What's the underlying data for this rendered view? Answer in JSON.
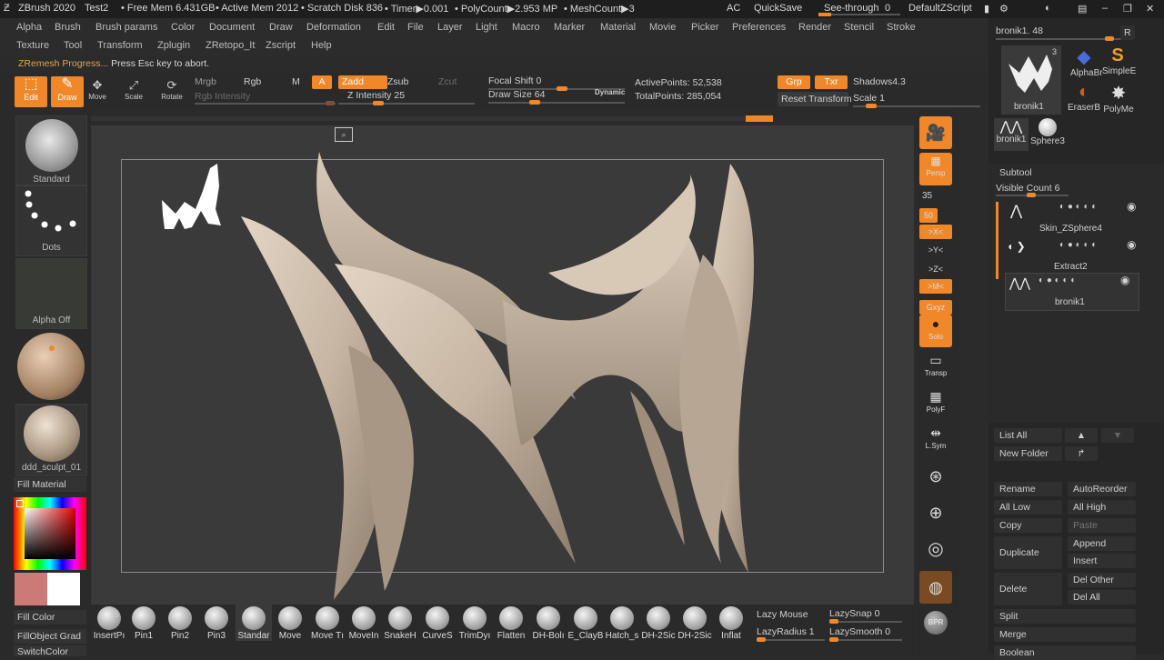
{
  "titlebar": {
    "app": "ZBrush 2020",
    "doc": "Test2",
    "free_mem": "• Free Mem 6.431GB",
    "active_mem": "• Active Mem 2012",
    "scratch": "• Scratch Disk 836",
    "timer": "• Timer▶0.001",
    "polycount": "• PolyCount▶2.953 MP",
    "meshcount": "• MeshCount▶3",
    "ac": "AC",
    "quicksave": "QuickSave",
    "seethrough": "See-through",
    "seethrough_val": "0",
    "zscript": "DefaultZScript"
  },
  "menu": {
    "row1": [
      "Alpha",
      "Brush",
      "Brush params",
      "Color",
      "Document",
      "Draw",
      "Deformation",
      "Edit",
      "File",
      "Layer",
      "Light",
      "Macro",
      "Marker",
      "Material",
      "Movie",
      "Picker",
      "Preferences",
      "Render",
      "Stencil",
      "Stroke"
    ],
    "row2": [
      "Texture",
      "Tool",
      "Transform",
      "Zplugin",
      "ZRetopo_It",
      "Zscript",
      "Help"
    ]
  },
  "status": {
    "progress": "ZRemesh Progress...",
    "hint": "Press Esc key to abort."
  },
  "toolbar": {
    "edit": "Edit",
    "draw": "Draw",
    "move": "Move",
    "scale": "Scale",
    "rotate": "Rotate",
    "mrgb": "Mrgb",
    "rgb": "Rgb",
    "m": "M",
    "a": "A",
    "rgb_intensity": "Rgb Intensity",
    "zadd": "Zadd",
    "zsub": "Zsub",
    "zcut": "Zcut",
    "z_intensity": "Z Intensity 25",
    "focal_shift": "Focal Shift 0",
    "draw_size": "Draw Size 64",
    "dynamic": "Dynamic",
    "active_points": "ActivePoints: 52,538",
    "total_points": "TotalPoints: 285,054",
    "grp": "Grp",
    "txr": "Txr",
    "shadows": "Shadows4.3",
    "reset_transform": "Reset Transform",
    "scale_val": "Scale 1",
    "z_intensity_frac": 0.25,
    "draw_size_frac": 0.3,
    "focal_shift_frac": 0.5,
    "scale_frac": 0.1
  },
  "left": {
    "brush": "Standard",
    "stroke": "Dots",
    "alpha": "Alpha Off",
    "material": "ddd_sculpt_01",
    "fill_material": "Fill Material",
    "fill_color": "Fill Color",
    "fill_object": "FillObject Grad",
    "switch_color": "SwitchColor"
  },
  "shelf": {
    "persp": "Persp",
    "fov": "35",
    "fifty": "50",
    "x": ">X<",
    "y": ">Y<",
    "z": ">Z<",
    "m": ">M<",
    "xyz": "Gxyz",
    "solo": "Solo",
    "transp": "Transp",
    "polyf": "PolyF",
    "lsym": "L.Sym",
    "bpr": "BPR"
  },
  "right": {
    "tool_name": "bronik1. 48",
    "r": "R",
    "tools": [
      "bronik1",
      "AlphaBr",
      "SimpleE",
      "EraserB",
      "PolyMe",
      "bronik1",
      "Sphere3"
    ],
    "tool_count": "3",
    "subtool_title": "Subtool",
    "visible_count": "Visible Count 6",
    "subtools": [
      "Skin_ZSphere4",
      "Extract2",
      "bronik1"
    ],
    "buttons": [
      "List All",
      "New Folder",
      "Rename",
      "AutoReorder",
      "All Low",
      "All High",
      "Copy",
      "Paste",
      "Duplicate",
      "Append",
      "Insert",
      "Delete",
      "Del Other",
      "Del All",
      "Split",
      "Merge",
      "Boolean"
    ]
  },
  "bottom": {
    "brushes": [
      "InsertPı",
      "Pin1",
      "Pin2",
      "Pin3",
      "Standar",
      "Move",
      "Move Tı",
      "MoveIn",
      "SnakeH",
      "CurveS",
      "TrimDyı",
      "Flatten",
      "DH-Bolı",
      "E_ClayB",
      "Hatch_s",
      "DH-2Sic",
      "DH-2Sic",
      "Inflat"
    ],
    "lazy_mouse": "Lazy Mouse",
    "lazy_radius": "LazyRadius 1",
    "lazy_snap": "LazySnap 0",
    "lazy_smooth": "LazySmooth 0",
    "insert_count": "5"
  },
  "colors": {
    "accent": "#f0882a",
    "bg": "#2b2b2b",
    "canvas": "#3a3a3a",
    "clay": "#c9b9a7"
  }
}
